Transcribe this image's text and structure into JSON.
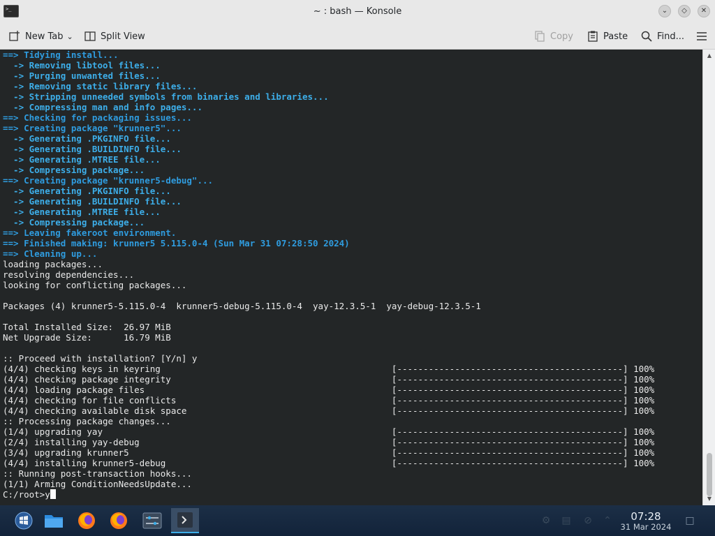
{
  "window": {
    "title": "~ : bash — Konsole",
    "app_icon_text": ">_"
  },
  "toolbar": {
    "new_tab": "New Tab",
    "split_view": "Split View",
    "copy": "Copy",
    "paste": "Paste",
    "find": "Find..."
  },
  "terminal": {
    "lines": [
      {
        "cls": "head",
        "text": "==> Tidying install..."
      },
      {
        "cls": "sub",
        "text": "  -> Removing libtool files..."
      },
      {
        "cls": "sub",
        "text": "  -> Purging unwanted files..."
      },
      {
        "cls": "sub",
        "text": "  -> Removing static library files..."
      },
      {
        "cls": "sub",
        "text": "  -> Stripping unneeded symbols from binaries and libraries..."
      },
      {
        "cls": "sub",
        "text": "  -> Compressing man and info pages..."
      },
      {
        "cls": "head",
        "text": "==> Checking for packaging issues..."
      },
      {
        "cls": "head",
        "text": "==> Creating package \"krunner5\"..."
      },
      {
        "cls": "sub",
        "text": "  -> Generating .PKGINFO file..."
      },
      {
        "cls": "sub",
        "text": "  -> Generating .BUILDINFO file..."
      },
      {
        "cls": "sub",
        "text": "  -> Generating .MTREE file..."
      },
      {
        "cls": "sub",
        "text": "  -> Compressing package..."
      },
      {
        "cls": "head",
        "text": "==> Creating package \"krunner5-debug\"..."
      },
      {
        "cls": "sub",
        "text": "  -> Generating .PKGINFO file..."
      },
      {
        "cls": "sub",
        "text": "  -> Generating .BUILDINFO file..."
      },
      {
        "cls": "sub",
        "text": "  -> Generating .MTREE file..."
      },
      {
        "cls": "sub",
        "text": "  -> Compressing package..."
      },
      {
        "cls": "head",
        "text": "==> Leaving fakeroot environment."
      },
      {
        "cls": "head",
        "text": "==> Finished making: krunner5 5.115.0-4 (Sun Mar 31 07:28:50 2024)"
      },
      {
        "cls": "head",
        "text": "==> Cleaning up..."
      },
      {
        "cls": "norm",
        "text": "loading packages..."
      },
      {
        "cls": "norm",
        "text": "resolving dependencies..."
      },
      {
        "cls": "norm",
        "text": "looking for conflicting packages..."
      },
      {
        "cls": "norm",
        "text": ""
      },
      {
        "cls": "norm",
        "text": "Packages (4) krunner5-5.115.0-4  krunner5-debug-5.115.0-4  yay-12.3.5-1  yay-debug-12.3.5-1"
      },
      {
        "cls": "norm",
        "text": ""
      },
      {
        "cls": "norm",
        "text": "Total Installed Size:  26.97 MiB"
      },
      {
        "cls": "norm",
        "text": "Net Upgrade Size:      16.79 MiB"
      },
      {
        "cls": "norm",
        "text": ""
      },
      {
        "cls": "norm",
        "text": ":: Proceed with installation? [Y/n] y"
      },
      {
        "cls": "norm",
        "text": "(4/4) checking keys in keyring                                            [-------------------------------------------] 100%"
      },
      {
        "cls": "norm",
        "text": "(4/4) checking package integrity                                          [-------------------------------------------] 100%"
      },
      {
        "cls": "norm",
        "text": "(4/4) loading package files                                               [-------------------------------------------] 100%"
      },
      {
        "cls": "norm",
        "text": "(4/4) checking for file conflicts                                         [-------------------------------------------] 100%"
      },
      {
        "cls": "norm",
        "text": "(4/4) checking available disk space                                       [-------------------------------------------] 100%"
      },
      {
        "cls": "norm",
        "text": ":: Processing package changes..."
      },
      {
        "cls": "norm",
        "text": "(1/4) upgrading yay                                                       [-------------------------------------------] 100%"
      },
      {
        "cls": "norm",
        "text": "(2/4) installing yay-debug                                                [-------------------------------------------] 100%"
      },
      {
        "cls": "norm",
        "text": "(3/4) upgrading krunner5                                                  [-------------------------------------------] 100%"
      },
      {
        "cls": "norm",
        "text": "(4/4) installing krunner5-debug                                           [-------------------------------------------] 100%"
      },
      {
        "cls": "norm",
        "text": ":: Running post-transaction hooks..."
      },
      {
        "cls": "norm",
        "text": "(1/1) Arming ConditionNeedsUpdate..."
      }
    ],
    "prompt": "C:/root>y"
  },
  "taskbar": {
    "apps": [
      "start-menu-icon",
      "file-manager-icon",
      "firefox-icon",
      "firefox-icon",
      "settings-icon",
      "terminal-icon"
    ],
    "clock_time": "07:28",
    "clock_date": "31 Mar 2024"
  },
  "colors": {
    "terminal_bg": "#232627",
    "heading_blue": "#2f9cdf",
    "sub_blue": "#3daee9",
    "taskbar_bg": "#1c2f46"
  }
}
